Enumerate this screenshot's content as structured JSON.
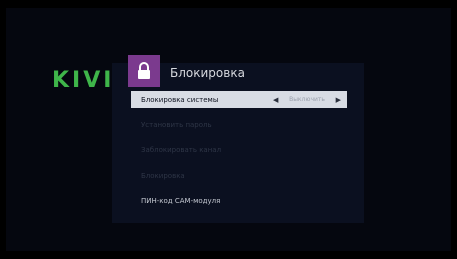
{
  "brand": {
    "logo_text": "KIVI",
    "logo_color": "#3fb54a"
  },
  "header": {
    "title": "Блокировка",
    "icon": "lock-icon",
    "icon_bg": "#7b3a8e"
  },
  "menu": {
    "items": [
      {
        "label": "Блокировка системы",
        "value": "Выключить",
        "selected": true,
        "enabled": true
      },
      {
        "label": "Установить пароль",
        "enabled": false
      },
      {
        "label": "Заблокировать канал",
        "enabled": false
      },
      {
        "label": "Блокировка",
        "enabled": false
      },
      {
        "label": "ПИН-код CAM-модуля",
        "enabled": true
      }
    ]
  },
  "colors": {
    "selected_bg": "#d8dce4",
    "panel_bg": "#0b1020",
    "background": "#000000"
  }
}
